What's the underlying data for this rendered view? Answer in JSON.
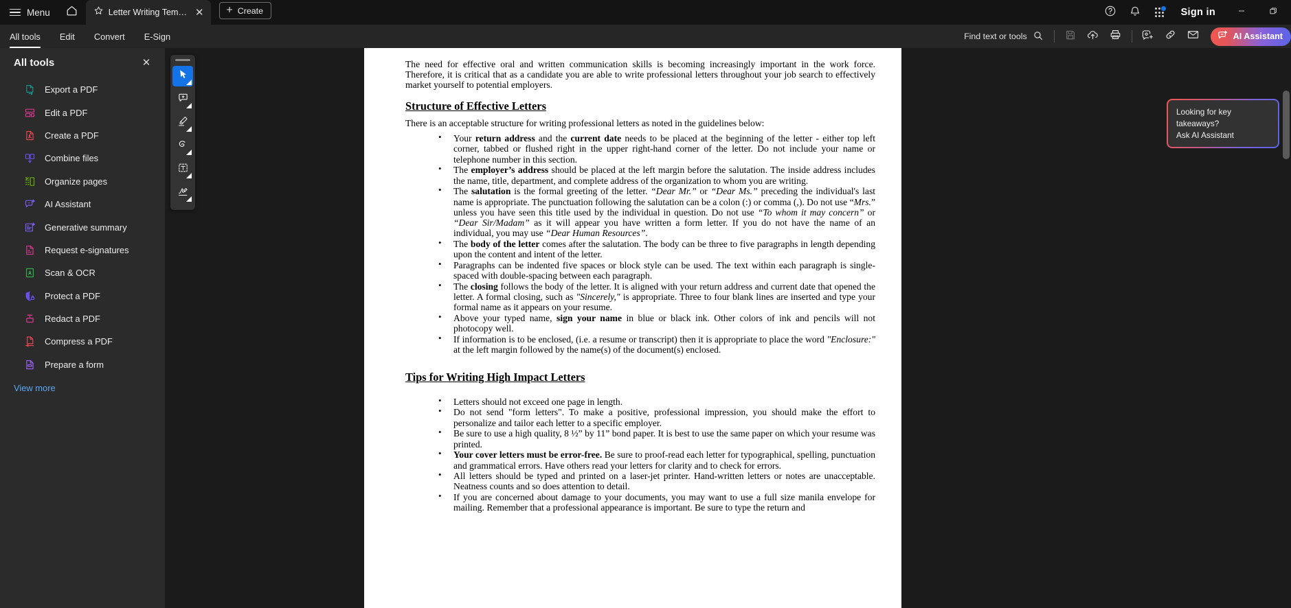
{
  "titlebar": {
    "menu_label": "Menu",
    "home_icon": "home-icon",
    "tab": {
      "star_icon": "star-icon",
      "title": "Letter Writing Template...",
      "close_icon": "close-icon"
    },
    "create_label": "Create",
    "help_icon": "help-circle-icon",
    "bell_icon": "bell-icon",
    "apps_icon": "app-grid-icon",
    "signin_label": "Sign in",
    "minimize_icon": "minimize-icon",
    "restore_icon": "restore-window-icon"
  },
  "menubar": {
    "tabs": [
      {
        "label": "All tools",
        "active": true
      },
      {
        "label": "Edit",
        "active": false
      },
      {
        "label": "Convert",
        "active": false
      },
      {
        "label": "E-Sign",
        "active": false
      }
    ],
    "find_label": "Find text or tools",
    "find_icon": "search-icon",
    "icons": [
      {
        "name": "save-icon",
        "disabled": true
      },
      {
        "name": "upload-cloud-icon",
        "disabled": false
      },
      {
        "name": "print-icon",
        "disabled": false
      },
      {
        "name": "add-comment-user-icon",
        "disabled": false
      },
      {
        "name": "link-icon",
        "disabled": false
      },
      {
        "name": "mail-icon",
        "disabled": false
      }
    ],
    "ai_assistant_label": "AI Assistant",
    "ai_assistant_icon": "ai-sparkle-chat-icon"
  },
  "sidebar": {
    "title": "All tools",
    "close_icon": "close-icon",
    "items": [
      {
        "label": "Export a PDF",
        "icon": "export-pdf-icon",
        "color": "#12948a"
      },
      {
        "label": "Edit a PDF",
        "icon": "edit-pdf-icon",
        "color": "#d83790"
      },
      {
        "label": "Create a PDF",
        "icon": "create-pdf-icon",
        "color": "#e34850"
      },
      {
        "label": "Combine files",
        "icon": "combine-files-icon",
        "color": "#6a4fe8"
      },
      {
        "label": "Organize pages",
        "icon": "organize-pages-icon",
        "color": "#6aa908"
      },
      {
        "label": "AI Assistant",
        "icon": "ai-assistant-icon",
        "color": "#7b5cf0"
      },
      {
        "label": "Generative summary",
        "icon": "generative-summary-icon",
        "color": "#7b5cf0"
      },
      {
        "label": "Request e-signatures",
        "icon": "request-esign-icon",
        "color": "#d83790"
      },
      {
        "label": "Scan & OCR",
        "icon": "scan-ocr-icon",
        "color": "#2eaf4a"
      },
      {
        "label": "Protect a PDF",
        "icon": "protect-pdf-icon",
        "color": "#6a4fe8"
      },
      {
        "label": "Redact a PDF",
        "icon": "redact-pdf-icon",
        "color": "#d83790"
      },
      {
        "label": "Compress a PDF",
        "icon": "compress-pdf-icon",
        "color": "#e34850"
      },
      {
        "label": "Prepare a form",
        "icon": "prepare-form-icon",
        "color": "#9a5ef0"
      }
    ],
    "view_more_label": "View more"
  },
  "annotation_toolbar": {
    "tools": [
      {
        "name": "select-tool",
        "icon": "cursor-arrow-icon",
        "selected": true
      },
      {
        "name": "comment-tool",
        "icon": "add-comment-icon",
        "selected": false
      },
      {
        "name": "highlight-tool",
        "icon": "highlighter-icon",
        "selected": false
      },
      {
        "name": "draw-tool",
        "icon": "freehand-draw-icon",
        "selected": false
      },
      {
        "name": "text-box-tool",
        "icon": "add-text-box-icon",
        "selected": false
      },
      {
        "name": "sign-tool",
        "icon": "signature-icon",
        "selected": false
      }
    ]
  },
  "ai_callout": {
    "line1": "Looking for key takeaways?",
    "line2": "Ask AI Assistant"
  },
  "document": {
    "intro": "The need for effective oral and written communication skills is becoming increasingly important in the work force.  Therefore, it is critical that as a candidate you are able to write professional letters throughout your job search to effectively market yourself to potential employers.",
    "section1_heading": "Structure of Effective Letters",
    "section1_lead": "There is an acceptable structure for writing professional letters as noted in the guidelines below:",
    "section1_bullets": [
      "Your <b>return address</b> and the <b>current date</b> needs to be placed at the beginning of the letter - either top left corner, tabbed or flushed right in the upper right-hand corner of the letter.  Do not include your name or telephone number in this section.",
      "The <b>employer&rsquo;s address</b> should be placed at the left margin before the salutation. The inside address includes the name, title, department, and complete address of the organization to whom you are writing.",
      "The <b>salutation</b> is the formal greeting of the letter.   <i>&ldquo;Dear Mr.&rdquo;</i> or <i>&ldquo;Dear Ms.&rdquo;</i> preceding the individual's last name is appropriate. The punctuation following the salutation can be a colon (:) or comma (,).  Do not use &ldquo;<i>Mrs.</i>&rdquo; unless you have seen this title used by the individual in question.  Do not use <i>&ldquo;To whom it may concern&rdquo;</i> or <i>&ldquo;Dear Sir/Madam&rdquo;</i> as it will appear you have written a form letter.  If you do not have the name of an individual, you may use <i>&ldquo;Dear Human Resources&rdquo;</i>.",
      "The <b>body of the letter</b> comes after the salutation.  The body can be three to five paragraphs in length depending upon the content and intent of the letter.",
      "Paragraphs can be indented five spaces or block style can be used.  The text within each paragraph is single-spaced with double-spacing between each paragraph.",
      "The <b>closing</b> follows the body of the letter.  It is aligned with your return address and current date that opened the letter. A formal closing, such as <i>\"Sincerely,\"</i> is appropriate.  Three to four blank lines are inserted and type your formal name as it appears on your resume.",
      "Above your typed name, <b>sign your name</b> in blue or black ink.  Other colors of ink and pencils will not photocopy well.",
      "If information is to be enclosed, (i.e. a resume or transcript) then it is appropriate to place the word <i>\"Enclosure:\"</i> at the left margin followed by the name(s) of the document(s) enclosed."
    ],
    "section2_heading": "Tips for Writing High Impact Letters",
    "section2_bullets": [
      "Letters should not exceed one page in length.",
      "Do not send \"form letters\".  To make a positive, professional impression, you should make the effort to personalize and tailor each letter to a specific employer.",
      "Be sure to use a high quality, 8 &frac12;&rdquo; by 11&rdquo; bond paper.  It is best to use the same paper on which your resume was printed.",
      "<b>Your cover letters must be error-free.</b>  Be sure to proof-read each letter for typographical, spelling, punctuation and grammatical errors.  Have others read your letters for clarity and to check for errors.",
      "All letters should be typed and printed on a laser-jet printer. Hand-written letters or notes are unacceptable.  Neatness counts and so does attention to detail.",
      "If you are concerned about damage to your documents, you may want to use a full size manila envelope for mailing. Remember that a professional appearance is important.  Be sure to type the return and"
    ]
  },
  "colors": {
    "titlebar_bg": "#141414",
    "menubar_bg": "#262626",
    "sidebar_bg": "#2b2b2b",
    "doc_area_bg": "#1b1b1b",
    "accent_blue": "#1473e6",
    "link_blue": "#5aa7f5"
  }
}
